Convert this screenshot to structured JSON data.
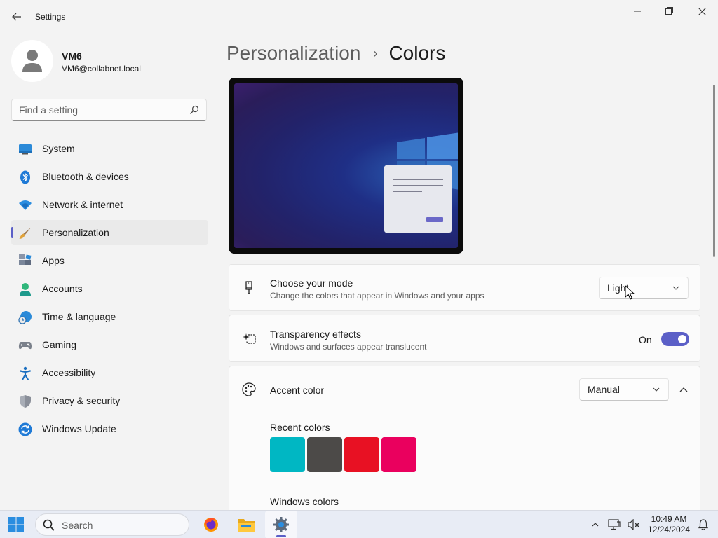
{
  "window": {
    "title": "Settings",
    "back_icon": "back-arrow-icon",
    "minimize_icon": "minimize-icon",
    "maximize_icon": "restore-icon",
    "close_icon": "close-icon"
  },
  "profile": {
    "name": "VM6",
    "email": "VM6@collabnet.local"
  },
  "search": {
    "placeholder": "Find a setting"
  },
  "sidebar": {
    "items": [
      {
        "label": "System",
        "icon": "system-icon",
        "active": false
      },
      {
        "label": "Bluetooth & devices",
        "icon": "bluetooth-icon",
        "active": false
      },
      {
        "label": "Network & internet",
        "icon": "wifi-icon",
        "active": false
      },
      {
        "label": "Personalization",
        "icon": "brush-icon",
        "active": true
      },
      {
        "label": "Apps",
        "icon": "apps-icon",
        "active": false
      },
      {
        "label": "Accounts",
        "icon": "accounts-icon",
        "active": false
      },
      {
        "label": "Time & language",
        "icon": "globe-clock-icon",
        "active": false
      },
      {
        "label": "Gaming",
        "icon": "gamepad-icon",
        "active": false
      },
      {
        "label": "Accessibility",
        "icon": "accessibility-icon",
        "active": false
      },
      {
        "label": "Privacy & security",
        "icon": "shield-icon",
        "active": false
      },
      {
        "label": "Windows Update",
        "icon": "update-icon",
        "active": false
      }
    ]
  },
  "breadcrumb": {
    "parent": "Personalization",
    "separator": "›",
    "current": "Colors"
  },
  "mode_card": {
    "title": "Choose your mode",
    "description": "Change the colors that appear in Windows and your apps",
    "value": "Light",
    "icon": "brush-mode-icon"
  },
  "transparency_card": {
    "title": "Transparency effects",
    "description": "Windows and surfaces appear translucent",
    "toggle_label": "On",
    "toggle_on": true,
    "icon": "sparkle-icon"
  },
  "accent_card": {
    "title": "Accent color",
    "value": "Manual",
    "icon": "palette-icon",
    "expanded": true,
    "recent_label": "Recent colors",
    "recent_colors": [
      "#00b7c3",
      "#4c4a48",
      "#e81123",
      "#ea005e"
    ],
    "windows_label": "Windows colors"
  },
  "colors": {
    "accent": "#5b5fc7"
  },
  "taskbar": {
    "search_label": "Search",
    "apps": [
      "firefox-icon",
      "file-explorer-icon",
      "settings-icon"
    ],
    "tray": [
      "chevron-up-icon",
      "network-icon",
      "volume-muted-icon"
    ],
    "time": "10:49 AM",
    "date": "12/24/2024",
    "notification_icon": "notification-bell-icon"
  }
}
